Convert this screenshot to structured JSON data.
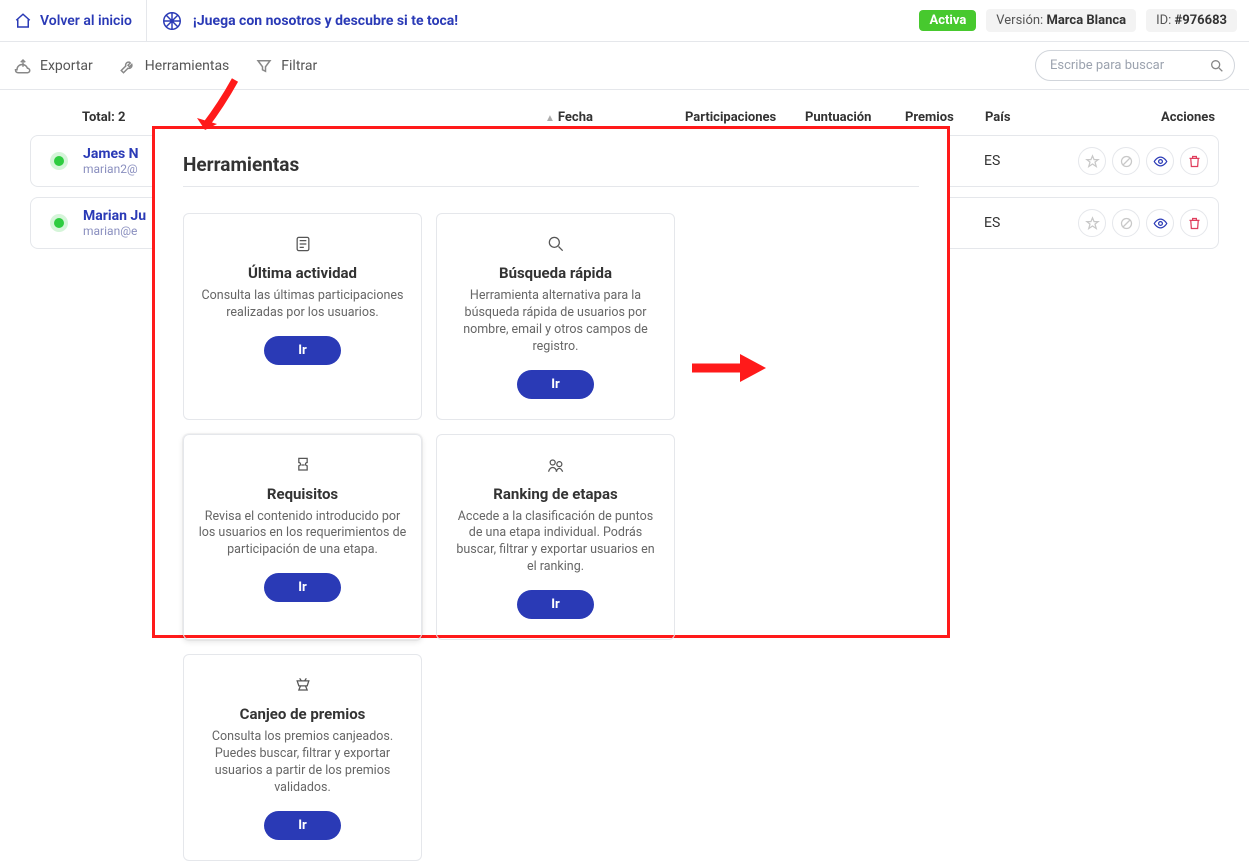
{
  "header": {
    "home": "Volver al inicio",
    "title": "¡Juega con nosotros y descubre si te toca!",
    "status": "Activa",
    "version_label": "Versión:",
    "version_value": "Marca Blanca",
    "id_label": "ID:",
    "id_value": "#976683"
  },
  "toolbar": {
    "export": "Exportar",
    "tools": "Herramientas",
    "filter": "Filtrar",
    "search_placeholder": "Escribe para buscar"
  },
  "table": {
    "total_label": "Total: 2",
    "cols": {
      "date": "Fecha",
      "participations": "Participaciones",
      "score": "Puntuación",
      "prizes": "Premios",
      "country": "País",
      "actions": "Acciones"
    },
    "rows": [
      {
        "name": "James N",
        "email": "marian2@",
        "country": "ES"
      },
      {
        "name": "Marian Ju",
        "email": "marian@e",
        "country": "ES"
      }
    ]
  },
  "modal": {
    "title": "Herramientas",
    "go": "Ir",
    "cards": [
      {
        "title": "Última actividad",
        "desc": "Consulta las últimas participaciones realizadas por los usuarios."
      },
      {
        "title": "Búsqueda rápida",
        "desc": "Herramienta alternativa para la búsqueda rápida de usuarios por nombre, email y otros campos de registro."
      },
      {
        "title": "Requisitos",
        "desc": "Revisa el contenido introducido por los usuarios en los requerimientos de participación de una etapa."
      },
      {
        "title": "Ranking de etapas",
        "desc": "Accede a la clasificación de puntos de una etapa individual. Podrás buscar, filtrar y exportar usuarios en el ranking."
      },
      {
        "title": "Canjeo de premios",
        "desc": "Consulta los premios canjeados. Puedes buscar, filtrar y exportar usuarios a partir de los premios validados."
      }
    ]
  }
}
